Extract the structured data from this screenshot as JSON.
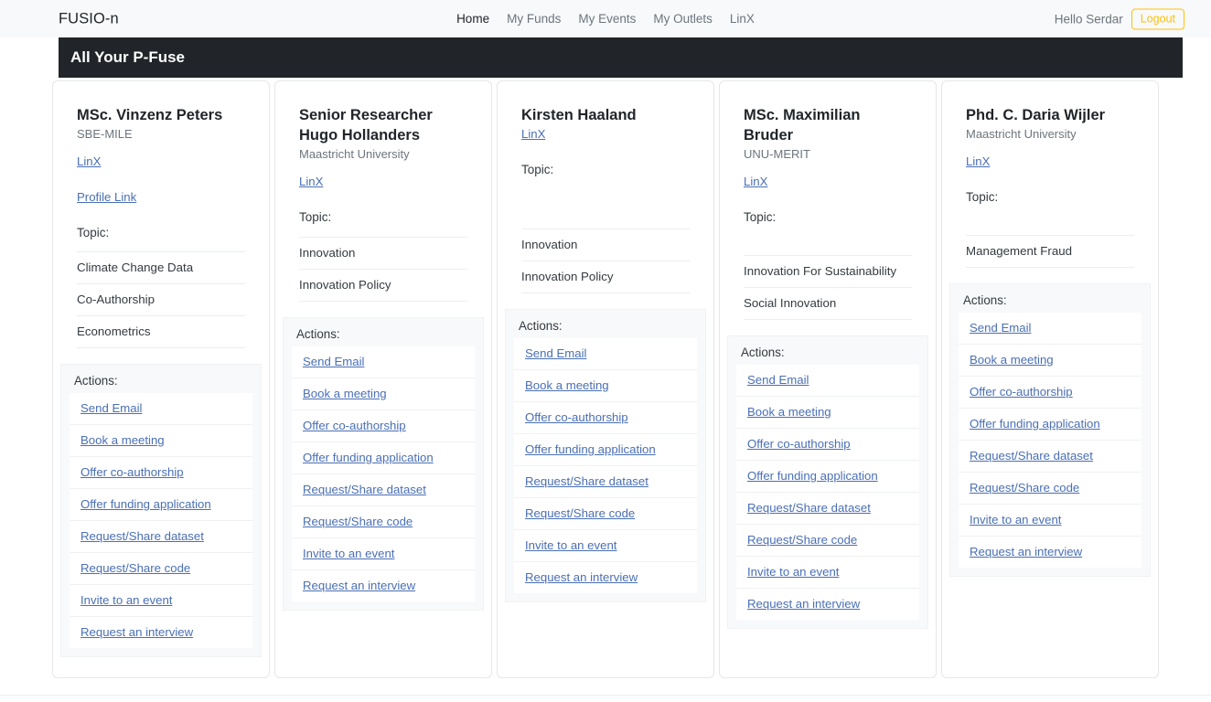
{
  "navbar": {
    "brand": "FUSIO-n",
    "links": [
      {
        "label": "Home",
        "active": true
      },
      {
        "label": "My Funds",
        "active": false
      },
      {
        "label": "My Events",
        "active": false
      },
      {
        "label": "My Outlets",
        "active": false
      },
      {
        "label": "LinX",
        "active": false
      }
    ],
    "greeting": "Hello Serdar",
    "logout_label": "Logout",
    "logout_color": "#ffc107"
  },
  "page_header": {
    "title": "All Your P-Fuse",
    "background": "#212529",
    "text_color": "#ffffff"
  },
  "labels": {
    "topic": "Topic:",
    "actions": "Actions:"
  },
  "colors": {
    "link": "#4a6fb5",
    "card_bg": "#ffffff",
    "actions_bg": "#f8f9fa",
    "navbar_bg": "#f8f9fa",
    "muted_text": "#6c757d"
  },
  "cards": [
    {
      "name": "MSc. Vinzenz Peters",
      "affiliation": "SBE-MILE",
      "links": [
        "LinX",
        "Profile Link"
      ],
      "topic_label": "Topic:",
      "topics": [
        "Climate Change Data",
        "Co-Authorship",
        "Econometrics"
      ],
      "actions_label": "Actions:",
      "actions": [
        "Send Email",
        "Book a meeting",
        "Offer co-authorship",
        "Offer funding application",
        "Request/Share dataset",
        "Request/Share code",
        "Invite to an event",
        "Request an interview"
      ]
    },
    {
      "name": "Senior Researcher Hugo Hollanders",
      "affiliation": "Maastricht University",
      "links": [
        "LinX"
      ],
      "topic_label": "Topic:",
      "topics": [
        "Innovation",
        "Innovation Policy"
      ],
      "actions_label": "Actions:",
      "actions": [
        "Send Email",
        "Book a meeting",
        "Offer co-authorship",
        "Offer funding application",
        "Request/Share dataset",
        "Request/Share code",
        "Invite to an event",
        "Request an interview"
      ]
    },
    {
      "name": "Kirsten Haaland",
      "affiliation": "",
      "links": [
        "LinX"
      ],
      "topic_label": "Topic:",
      "topics": [
        "Innovation",
        "Innovation Policy"
      ],
      "actions_label": "Actions:",
      "actions": [
        "Send Email",
        "Book a meeting",
        "Offer co-authorship",
        "Offer funding application",
        "Request/Share dataset",
        "Request/Share code",
        "Invite to an event",
        "Request an interview"
      ]
    },
    {
      "name": "MSc. Maximilian Bruder",
      "affiliation": "UNU-MERIT",
      "links": [
        "LinX"
      ],
      "topic_label": "Topic:",
      "topics": [
        "Innovation For Sustainability",
        "Social Innovation"
      ],
      "actions_label": "Actions:",
      "actions": [
        "Send Email",
        "Book a meeting",
        "Offer co-authorship",
        "Offer funding application",
        "Request/Share dataset",
        "Request/Share code",
        "Invite to an event",
        "Request an interview"
      ]
    },
    {
      "name": "Phd. C. Daria Wijler",
      "affiliation": "Maastricht University",
      "links": [
        "LinX"
      ],
      "topic_label": "Topic:",
      "topics": [
        "Management Fraud"
      ],
      "actions_label": "Actions:",
      "actions": [
        "Send Email",
        "Book a meeting",
        "Offer co-authorship",
        "Offer funding application",
        "Request/Share dataset",
        "Request/Share code",
        "Invite to an event",
        "Request an interview"
      ]
    }
  ]
}
